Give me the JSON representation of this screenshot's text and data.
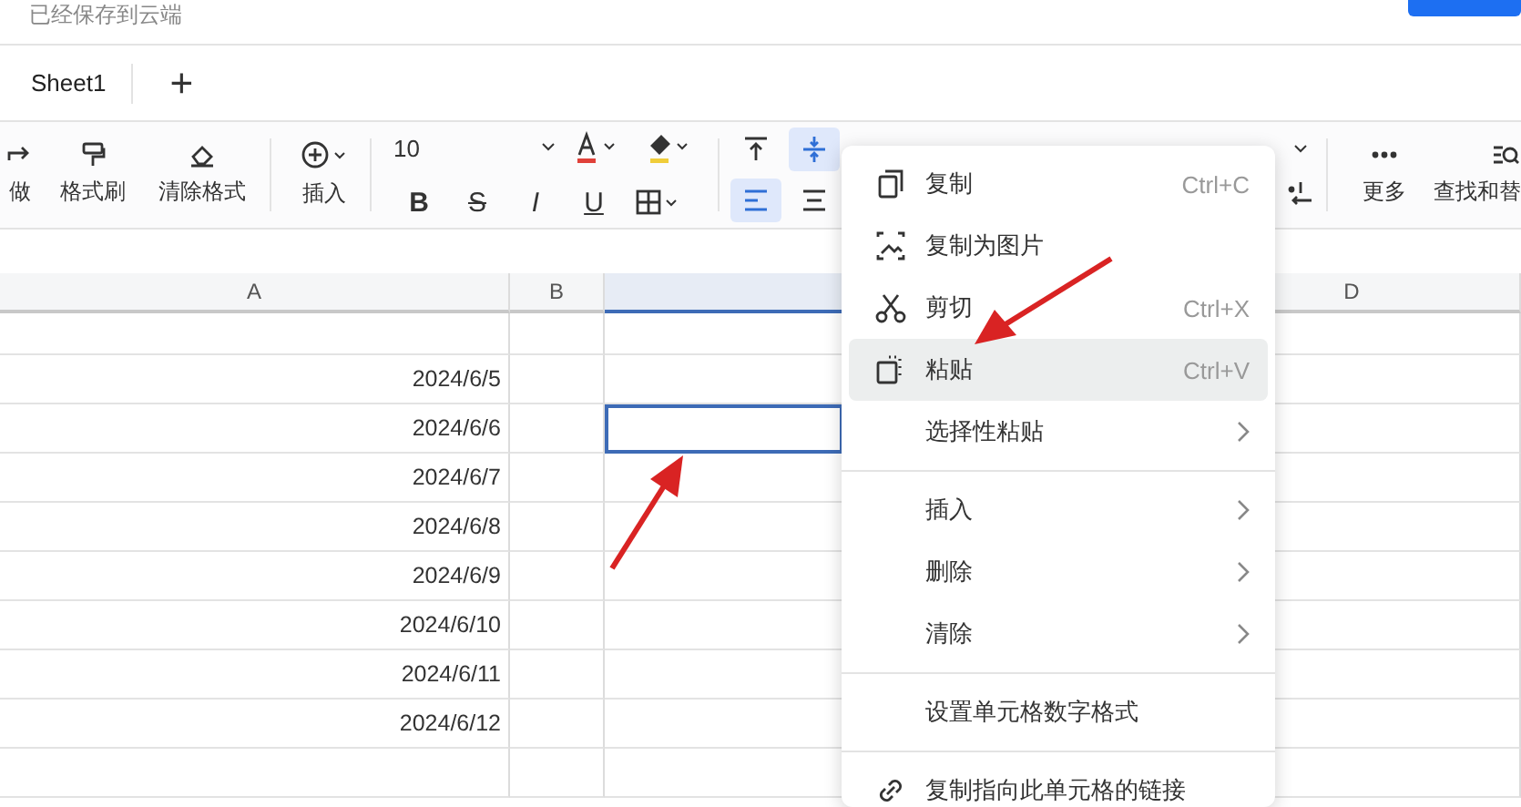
{
  "top_bar": {
    "status": "已经保存到云端"
  },
  "sheet_tabs": [
    {
      "label": "Sheet1",
      "selected": true
    }
  ],
  "add_sheet": "+",
  "toolbar": {
    "labels": [
      "做",
      "格式刷",
      "清除格式",
      "插入",
      "更多",
      "查找和替"
    ],
    "font_size": "10",
    "text_buttons": [
      "B",
      "S",
      "I",
      "U"
    ],
    "align_buttons": [
      {
        "selected": false
      },
      {
        "selected": true
      },
      {
        "selected": true
      },
      {
        "selected": false
      }
    ]
  },
  "columns": [
    {
      "label": "A",
      "selected": false
    },
    {
      "label": "B",
      "selected": false
    },
    {
      "selected": true
    },
    {
      "label": "D",
      "selected": false
    }
  ],
  "rows": [
    {
      "selected": false
    },
    {
      "date": "2024/6/5",
      "selected": false
    },
    {
      "date": "2024/6/6",
      "selected": true
    },
    {
      "date": "2024/6/7",
      "selected": false
    },
    {
      "date": "2024/6/8",
      "selected": false
    },
    {
      "date": "2024/6/9",
      "selected": false
    },
    {
      "date": "2024/6/10",
      "selected": false
    },
    {
      "date": "2024/6/11",
      "selected": false
    },
    {
      "date": "2024/6/12",
      "selected": false
    },
    {
      "selected": false
    }
  ],
  "context_menu": [
    {
      "kind": "item",
      "label": "复制",
      "shortcut": "Ctrl+C",
      "submenu": false,
      "selected": false
    },
    {
      "kind": "item",
      "label": "复制为图片",
      "submenu": false,
      "selected": false
    },
    {
      "kind": "item",
      "label": "剪切",
      "shortcut": "Ctrl+X",
      "submenu": false,
      "selected": false
    },
    {
      "kind": "item",
      "label": "粘贴",
      "shortcut": "Ctrl+V",
      "submenu": false,
      "selected": true
    },
    {
      "kind": "item",
      "label": "选择性粘贴",
      "submenu": true,
      "selected": false
    },
    {
      "kind": "separator"
    },
    {
      "kind": "item",
      "label": "插入",
      "submenu": true,
      "selected": false
    },
    {
      "kind": "item",
      "label": "删除",
      "submenu": true,
      "selected": false
    },
    {
      "kind": "item",
      "label": "清除",
      "submenu": true,
      "selected": false
    },
    {
      "kind": "separator"
    },
    {
      "kind": "item",
      "label": "设置单元格数字格式",
      "submenu": false,
      "selected": false
    },
    {
      "kind": "separator"
    },
    {
      "kind": "item",
      "label": "复制指向此单元格的链接",
      "submenu": false,
      "selected": false
    }
  ]
}
